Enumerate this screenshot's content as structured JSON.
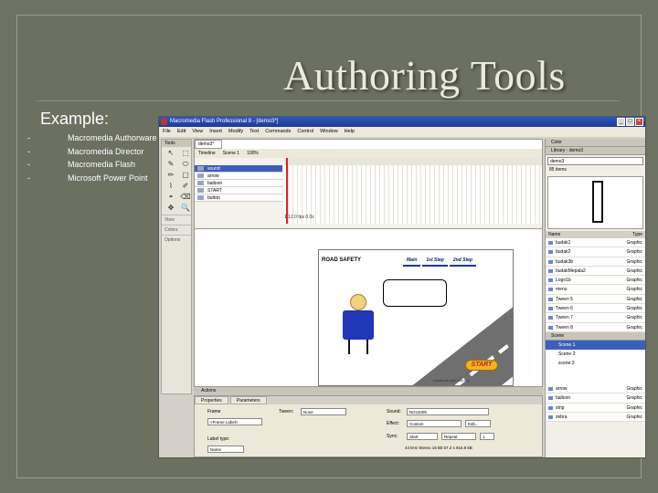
{
  "slide": {
    "title": "Authoring Tools",
    "subtitle": "Example:",
    "bullets": [
      {
        "marker": "-",
        "text": "Macromedia Authorware"
      },
      {
        "marker": "-",
        "text": "Macromedia Director"
      },
      {
        "marker": "-",
        "text": "Macromedia Flash"
      },
      {
        "marker": "-",
        "text": "Microsoft Power Point"
      }
    ]
  },
  "window": {
    "title": "Macromedia Flash Professional 8 - [demo3*]",
    "menu": [
      "File",
      "Edit",
      "View",
      "Insert",
      "Modify",
      "Text",
      "Commands",
      "Control",
      "Window",
      "Help"
    ],
    "controls": [
      "_",
      "□",
      "×"
    ]
  },
  "tools": {
    "header": "Tools",
    "glyphs": [
      "↖",
      "⬚",
      "✎",
      "⬭",
      "✏",
      "▢",
      "⌇",
      "✐",
      "◓",
      "⌫",
      "✥",
      "🔍"
    ],
    "view_label": "View",
    "colors_label": "Colors",
    "options_label": "Options"
  },
  "document": {
    "tab": "demo3*",
    "scene": "Scene 1",
    "timeline_label": "Timeline",
    "layers": [
      "sound",
      "arrow",
      "balloon",
      "START",
      "button"
    ],
    "status": "1   12.0 fps   0.0s",
    "zoom": "100%"
  },
  "stage": {
    "road_title": "ROAD SAFETY",
    "tabs": [
      "Main",
      "1st Step",
      "2nd Step"
    ],
    "start_label": "START",
    "credit": "roadtools.upm.edu.my"
  },
  "actions": {
    "label": "Actions"
  },
  "properties": {
    "tabs": [
      "Properties",
      "Parameters"
    ],
    "frame_label": "Frame",
    "frame_value": "<Frame Label>",
    "label_type": "Label type:",
    "label_type_value": "Name",
    "tween_label": "Tween:",
    "tween_value": "None",
    "sound_label": "Sound:",
    "sound_value": "NG11005",
    "effect_label": "Effect:",
    "effect_value": "Custom",
    "edit_label": "Edit...",
    "sync_label": "Sync:",
    "sync_value": "Start",
    "repeat_value": "Repeat",
    "repeat_count": "1",
    "sound_info": "44 kHz Stereo 16 Bit 57.2 s 916.9 kB"
  },
  "library": {
    "color_header": "Color",
    "header": "Library - demo3",
    "selected_doc": "demo3",
    "item_count": "85 items",
    "columns": [
      "Name",
      "Type"
    ],
    "items": [
      {
        "name": "budak1",
        "type": "Graphic"
      },
      {
        "name": "budak2",
        "type": "Graphic"
      },
      {
        "name": "budak3b",
        "type": "Graphic"
      },
      {
        "name": "budakMepala2",
        "type": "Graphic"
      },
      {
        "name": "Logo1b",
        "type": "Graphic"
      },
      {
        "name": "menu",
        "type": "Graphic"
      },
      {
        "name": "Tween 5",
        "type": "Graphic"
      },
      {
        "name": "Tween 6",
        "type": "Graphic"
      },
      {
        "name": "Tween 7",
        "type": "Graphic"
      },
      {
        "name": "Tween 8",
        "type": "Graphic"
      }
    ],
    "scene_header": "Scene",
    "scenes": [
      "Scene 1",
      "Scene 2",
      "scene 3"
    ],
    "bottom_items": [
      {
        "name": "arrow",
        "type": "Graphic"
      },
      {
        "name": "balloon",
        "type": "Graphic"
      },
      {
        "name": "strip",
        "type": "Graphic"
      },
      {
        "name": "zebra",
        "type": "Graphic"
      }
    ]
  }
}
